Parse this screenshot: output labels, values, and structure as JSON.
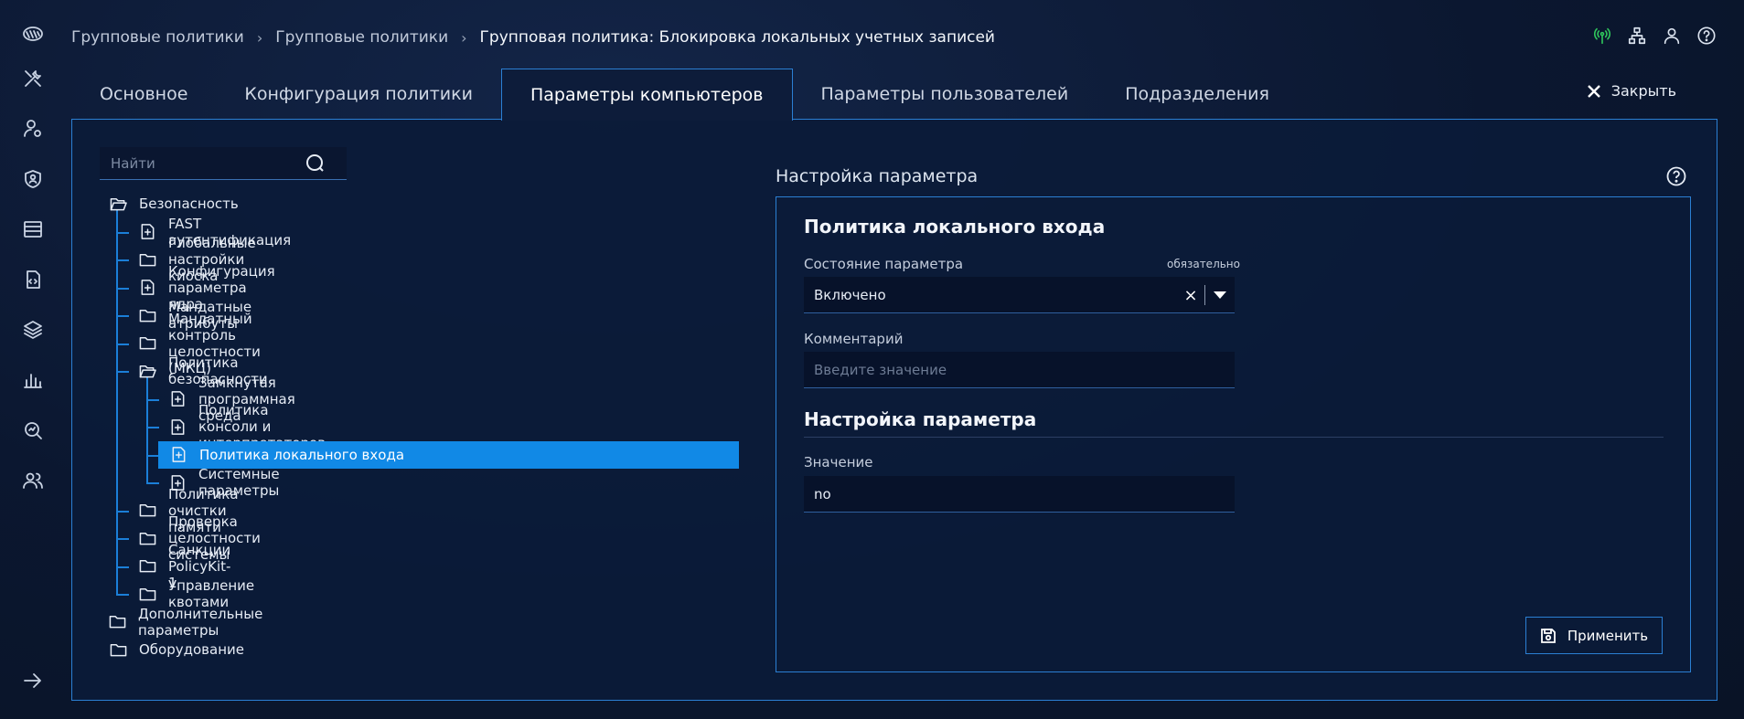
{
  "breadcrumb": {
    "items": [
      "Групповые политики",
      "Групповые политики"
    ],
    "current": "Групповая политика: Блокировка локальных учетных записей"
  },
  "tabs": [
    {
      "label": "Основное",
      "active": false
    },
    {
      "label": "Конфигурация политики",
      "active": false
    },
    {
      "label": "Параметры компьютеров",
      "active": true
    },
    {
      "label": "Параметры пользователей",
      "active": false
    },
    {
      "label": "Подразделения",
      "active": false
    }
  ],
  "close_label": "Закрыть",
  "search": {
    "placeholder": "Найти"
  },
  "tree": [
    {
      "label": "Безопасность",
      "level": 0,
      "icon": "folder-open-icon"
    },
    {
      "label": "FAST аутентификация",
      "level": 1,
      "icon": "file-settings-icon"
    },
    {
      "label": "Глобальные настройки киоска",
      "level": 1,
      "icon": "folder-icon"
    },
    {
      "label": "Конфигурация параметра ядра",
      "level": 1,
      "icon": "file-settings-icon"
    },
    {
      "label": "Мандатные атрибуты",
      "level": 1,
      "icon": "folder-icon"
    },
    {
      "label": "Мандатный контроль целостности (МКЦ)",
      "level": 1,
      "icon": "folder-icon"
    },
    {
      "label": "Политика безопасности",
      "level": 1,
      "icon": "folder-open-icon"
    },
    {
      "label": "Замкнутая программная среда",
      "level": 2,
      "icon": "file-settings-icon"
    },
    {
      "label": "Политика консоли и интерпретаторов",
      "level": 2,
      "icon": "file-settings-icon"
    },
    {
      "label": "Политика локального входа",
      "level": 2,
      "icon": "file-settings-icon",
      "selected": true
    },
    {
      "label": "Системные параметры",
      "level": 2,
      "icon": "file-settings-icon"
    },
    {
      "label": "Политика очистки памяти",
      "level": 1,
      "icon": "folder-icon"
    },
    {
      "label": "Проверка целостности системы",
      "level": 1,
      "icon": "folder-icon"
    },
    {
      "label": "Санкции PolicyKit-1",
      "level": 1,
      "icon": "folder-icon"
    },
    {
      "label": "Управление квотами",
      "level": 1,
      "icon": "folder-icon"
    },
    {
      "label": "Дополнительные параметры",
      "level": 0,
      "icon": "folder-icon"
    },
    {
      "label": "Оборудование",
      "level": 0,
      "icon": "folder-icon"
    }
  ],
  "settings": {
    "section_title": "Настройка параметра",
    "policy_title": "Политика локального входа",
    "state_label": "Состояние параметра",
    "required_label": "обязательно",
    "state_value": "Включено",
    "comment_label": "Комментарий",
    "comment_placeholder": "Введите значение",
    "param_section_title": "Настройка параметра",
    "value_label": "Значение",
    "value": "no",
    "apply_label": "Применить"
  },
  "colors": {
    "accent": "#2b7fd3",
    "selected": "#1189e6",
    "background": "#0b1730",
    "status_green": "#2fc45b"
  }
}
